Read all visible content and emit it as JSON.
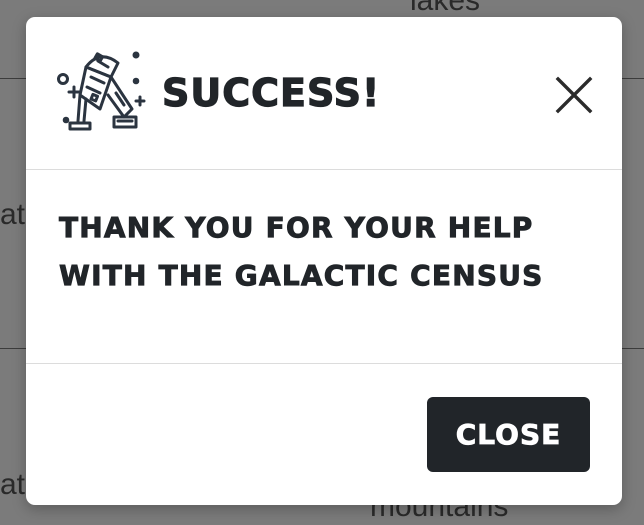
{
  "background": {
    "top_text": "lakes",
    "left_text_upper": "at",
    "left_text_lower": "at",
    "bottom_text": "mountains"
  },
  "modal": {
    "icon": "r2d2-robot-icon",
    "title": "SUCCESS!",
    "close_icon": "close-icon",
    "message": "THANK YOU FOR YOUR HELP WITH THE GALACTIC CENSUS",
    "button_label": "CLOSE"
  },
  "colors": {
    "dark": "#212529",
    "backdrop": "#7b7b7b",
    "white": "#ffffff"
  }
}
